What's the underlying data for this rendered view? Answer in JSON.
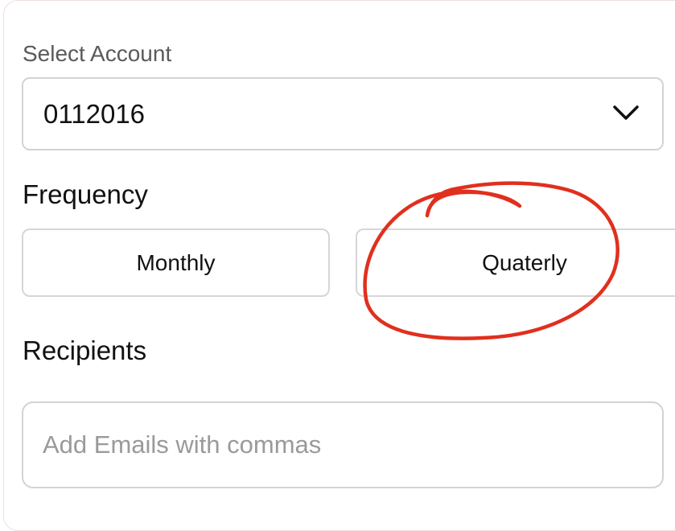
{
  "form": {
    "select_account_label": "Select Account",
    "select_account_value": "0112016",
    "frequency_label": "Frequency",
    "frequency_options": [
      "Monthly",
      "Quaterly"
    ],
    "recipients_label": "Recipients",
    "recipients_placeholder": "Add Emails with commas"
  },
  "icons": {
    "select_chevron": "chevron-down-icon"
  },
  "colors": {
    "annotation_stroke": "#e0301e",
    "border": "#d3d3d3",
    "placeholder": "#9a9a9a"
  }
}
